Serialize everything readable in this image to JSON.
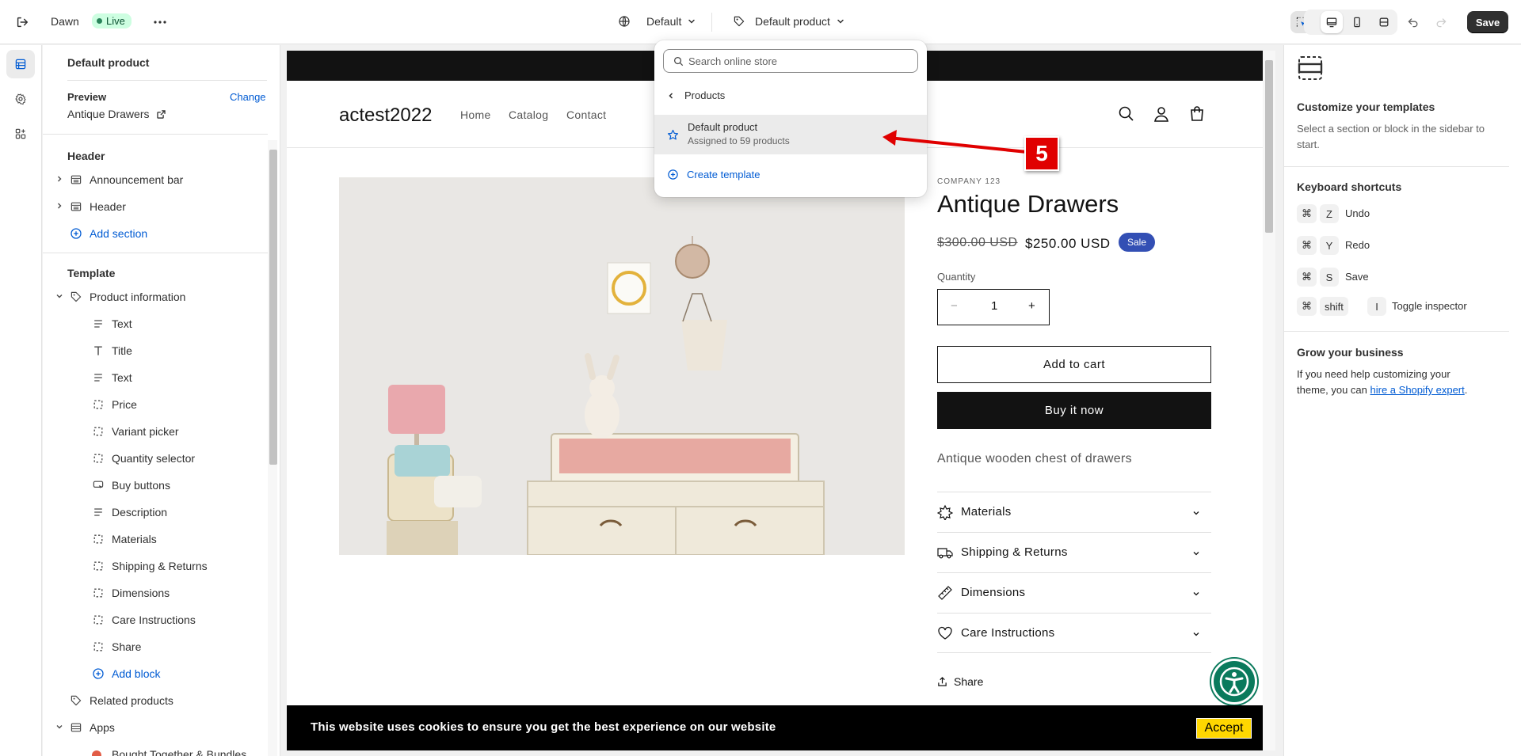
{
  "topbar": {
    "theme_name": "Dawn",
    "live_badge": "Live",
    "more_icon": "more-horizontal-icon",
    "locale_dropdown": "Default",
    "template_dropdown": "Default product",
    "save_label": "Save"
  },
  "sidebar": {
    "title": "Default product",
    "preview_label": "Preview",
    "change_link": "Change",
    "preview_value": "Antique Drawers",
    "header_group": "Header",
    "header_items": [
      "Announcement bar",
      "Header"
    ],
    "add_section": "Add section",
    "template_group": "Template",
    "product_info": "Product information",
    "blocks": [
      "Text",
      "Title",
      "Text",
      "Price",
      "Variant picker",
      "Quantity selector",
      "Buy buttons",
      "Description",
      "Materials",
      "Shipping & Returns",
      "Dimensions",
      "Care Instructions",
      "Share"
    ],
    "add_block": "Add block",
    "related_products": "Related products",
    "apps": "Apps",
    "app_item": "Bought Together & Bundles"
  },
  "dropdown": {
    "search_placeholder": "Search online store",
    "back_label": "Products",
    "selected_title": "Default product",
    "selected_sub": "Assigned to 59 products",
    "create_label": "Create template"
  },
  "annotation": {
    "step": "5",
    "color": "#e00000"
  },
  "preview": {
    "store_name": "actest2022",
    "nav": [
      "Home",
      "Catalog",
      "Contact"
    ],
    "vendor": "COMPANY 123",
    "product_title": "Antique Drawers",
    "price_old": "$300.00 USD",
    "price_new": "$250.00 USD",
    "sale_badge": "Sale",
    "quantity_label": "Quantity",
    "quantity_value": "1",
    "add_to_cart": "Add to cart",
    "buy_now": "Buy it now",
    "description": "Antique wooden chest of drawers",
    "accordions": [
      "Materials",
      "Shipping & Returns",
      "Dimensions",
      "Care Instructions"
    ],
    "share": "Share",
    "cookie_text": "This website uses cookies to ensure you get the best experience on our website",
    "cookie_accept": "Accept"
  },
  "right_panel": {
    "title": "Customize your templates",
    "subtitle": "Select a section or block in the sidebar to start.",
    "shortcuts_title": "Keyboard shortcuts",
    "shortcuts": [
      {
        "keys": [
          "Z"
        ],
        "label": "Undo"
      },
      {
        "keys": [
          "Y"
        ],
        "label": "Redo"
      },
      {
        "keys": [
          "S"
        ],
        "label": "Save"
      },
      {
        "keys": [
          "shift",
          "I"
        ],
        "label": "Toggle inspector"
      }
    ],
    "grow_title": "Grow your business",
    "grow_text": "If you need help customizing your theme, you can",
    "grow_link": "hire a Shopify expert",
    "grow_end": "."
  },
  "colors": {
    "accent": "#005bd3",
    "live_bg": "#cdfee1",
    "sale": "#334fb4",
    "a11y": "#0a7a5c"
  }
}
